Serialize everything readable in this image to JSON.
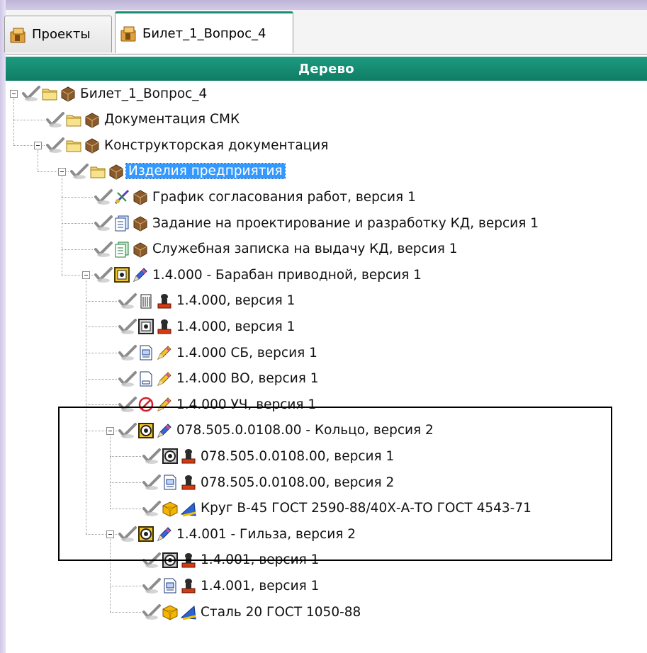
{
  "tabs": [
    {
      "label": "Проекты",
      "icon": "project-folder-icon",
      "active": false
    },
    {
      "label": "Билет_1_Вопрос_4",
      "icon": "project-folder-icon",
      "active": true
    }
  ],
  "panel": {
    "title": "Дерево"
  },
  "tree": {
    "rows": [
      {
        "label": "Билет_1_Вопрос_4",
        "icon": "folder-icon",
        "icon2": "package-icon",
        "level": 0,
        "expander": true
      },
      {
        "label": "Документация СМК",
        "icon": "folder-icon",
        "icon2": "package-icon",
        "level": 1,
        "expander": false
      },
      {
        "label": "Конструкторская документация",
        "icon": "folder-icon",
        "icon2": "package-icon",
        "level": 1,
        "expander": true
      },
      {
        "label": "Изделия предприятия",
        "icon": "folder-icon",
        "icon2": "package-icon",
        "level": 2,
        "expander": true,
        "selected": true
      },
      {
        "label": "График согласования работ, версия 1",
        "icon": "schedule-icon",
        "icon2": "package-icon",
        "level": 3,
        "expander": false
      },
      {
        "label": "Задание на проектирование и разработку КД, версия 1",
        "icon": "document-stack-icon",
        "icon2": "package-icon",
        "level": 3,
        "expander": false
      },
      {
        "label": "Служебная записка на выдачу КД, версия 1",
        "icon": "document-green-icon",
        "icon2": "package-icon",
        "level": 3,
        "expander": false
      },
      {
        "label": "1.4.000 - Барабан приводной, версия 1",
        "icon": "assembly-icon",
        "icon2": "pencil-blue-icon",
        "level": 3,
        "expander": true
      },
      {
        "label": "1.4.000, версия 1",
        "icon": "building-icon",
        "icon2": "stamp-icon",
        "level": 4,
        "expander": false
      },
      {
        "label": "1.4.000, версия 1",
        "icon": "assembly-gray-icon",
        "icon2": "stamp-icon",
        "level": 4,
        "expander": false
      },
      {
        "label": "1.4.000 СБ, версия 1",
        "icon": "drawing-icon",
        "icon2": "pencil-yellow-icon",
        "level": 4,
        "expander": false
      },
      {
        "label": "1.4.000 ВО, версия 1",
        "icon": "blank-doc-icon",
        "icon2": "pencil-yellow-icon",
        "level": 4,
        "expander": false
      },
      {
        "label": "1.4.000 УЧ, версия 1",
        "icon": "no-entry-icon",
        "icon2": "pencil-yellow-icon",
        "level": 4,
        "expander": false
      },
      {
        "label": "078.505.0.0108.00 - Кольцо, версия 2",
        "icon": "part-icon",
        "icon2": "pencil-blue-icon",
        "level": 4,
        "expander": true
      },
      {
        "label": "078.505.0.0108.00, версия 1",
        "icon": "part-gray-icon",
        "icon2": "stamp-icon",
        "level": 5,
        "expander": false
      },
      {
        "label": "078.505.0.0108.00, версия 2",
        "icon": "drawing-icon",
        "icon2": "stamp-icon",
        "level": 5,
        "expander": false
      },
      {
        "label": "Круг В-45 ГОСТ 2590-88/40Х-А-ТО ГОСТ 4543-71",
        "icon": "material-box-icon",
        "icon2": "ruler-icon",
        "level": 5,
        "expander": false
      },
      {
        "label": "1.4.001 - Гильза, версия 2",
        "icon": "part-icon",
        "icon2": "pencil-blue-icon",
        "level": 4,
        "expander": true
      },
      {
        "label": "1.4.001, версия 1",
        "icon": "part-gray-icon",
        "icon2": "stamp-icon",
        "level": 5,
        "expander": false
      },
      {
        "label": "1.4.001, версия 1",
        "icon": "drawing-icon",
        "icon2": "stamp-icon",
        "level": 5,
        "expander": false
      },
      {
        "label": "Сталь 20 ГОСТ 1050-88",
        "icon": "material-box-icon",
        "icon2": "ruler-icon",
        "level": 5,
        "expander": false
      }
    ]
  },
  "colors": {
    "header": "#138a70",
    "selection": "#3399ff",
    "check": "#8a8a8a"
  }
}
